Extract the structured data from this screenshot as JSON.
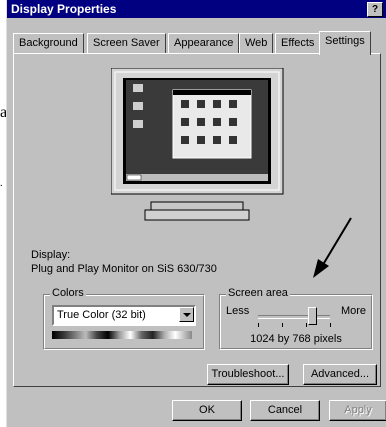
{
  "page": {
    "stray_left_char": "a",
    "stray_dot": "."
  },
  "window": {
    "title": "Display Properties",
    "help_label": "?"
  },
  "tabs": [
    {
      "label": "Background"
    },
    {
      "label": "Screen Saver"
    },
    {
      "label": "Appearance"
    },
    {
      "label": "Web"
    },
    {
      "label": "Effects"
    },
    {
      "label": "Settings",
      "active": true
    }
  ],
  "display": {
    "label": "Display:",
    "value": "Plug and Play Monitor on SiS 630/730"
  },
  "colors": {
    "title": "Colors",
    "selected": "True Color (32 bit)"
  },
  "screen_area": {
    "title": "Screen area",
    "less_label": "Less",
    "more_label": "More",
    "resolution_text": "1024 by 768 pixels",
    "slider_level": 0.75
  },
  "buttons": {
    "troubleshoot": "Troubleshoot...",
    "advanced": "Advanced...",
    "ok": "OK",
    "cancel": "Cancel",
    "apply": "Apply"
  },
  "colors_theme": {
    "titlebar": "#000080",
    "face": "#c0c0c0",
    "desktop": "#008080"
  }
}
